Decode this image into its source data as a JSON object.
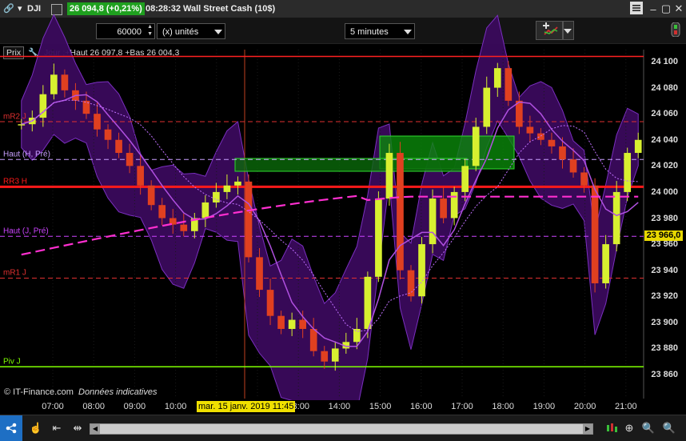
{
  "titlebar": {
    "symbol": "DJI",
    "quote": "26 094,8 (+0,21%)",
    "quote_color": "#1fa01f",
    "time": "08:28:32",
    "instrument": "Wall Street Cash (10$)"
  },
  "toolbar": {
    "units_value": "60000",
    "units_label": "(x) unités",
    "interval": "5 minutes"
  },
  "legend": {
    "price_label": "Prix",
    "day_info": "Jour :+Haut 26 097,8 +Bas 26 004,3"
  },
  "levels": [
    {
      "label": "mR2 J",
      "value": 24054,
      "color": "#e03030",
      "style": "dash"
    },
    {
      "label": "Haut (H, Pré)",
      "value": 24025,
      "color": "#c9a0ff",
      "style": "dash"
    },
    {
      "label": "RR3 H",
      "value": 24004,
      "color": "#ff1a1a",
      "style": "solid"
    },
    {
      "label": "Haut (J, Pré)",
      "value": 23966,
      "color": "#cc44ff",
      "style": "dash"
    },
    {
      "label": "mR1 J",
      "value": 23934,
      "color": "#e03030",
      "style": "dash"
    },
    {
      "label": "Piv J",
      "value": 23866,
      "color": "#7fff00",
      "style": "solid"
    }
  ],
  "top_line_value": 24104,
  "current_price_label": "23 966,0",
  "watermark": "© IT-Finance.com",
  "watermark_note": "Données indicatives",
  "cursor_label": "mar. 15 janv. 2019 11:45",
  "chart_data": {
    "type": "candlestick",
    "y_ticks": [
      "24 100",
      "24 080",
      "24 060",
      "24 040",
      "24 020",
      "24 000",
      "23 980",
      "23 960",
      "23 940",
      "23 920",
      "23 900",
      "23 880",
      "23 860"
    ],
    "y_values": [
      24100,
      24080,
      24060,
      24040,
      24020,
      24000,
      23980,
      23960,
      23940,
      23920,
      23900,
      23880,
      23860
    ],
    "ylim": [
      23851,
      24106
    ],
    "x_ticks": [
      "07:00",
      "08:00",
      "09:00",
      "10:00",
      "11:00",
      "12:00",
      "13:00",
      "14:00",
      "15:00",
      "16:00",
      "17:00",
      "18:00",
      "19:00",
      "20:00",
      "21:00"
    ],
    "close_path": [
      24052,
      24057,
      24075,
      24090,
      24078,
      24070,
      24060,
      24048,
      24040,
      24030,
      24020,
      24005,
      23990,
      23980,
      23975,
      23970,
      23980,
      23992,
      24000,
      24005,
      24008,
      23950,
      23925,
      23905,
      23895,
      23902,
      23895,
      23878,
      23870,
      23880,
      23885,
      23895,
      23935,
      23995,
      24030,
      23940,
      23920,
      23960,
      23995,
      23980,
      24000,
      24020,
      24050,
      24080,
      24095,
      24070,
      24050,
      24045,
      24040,
      24035,
      24025,
      24015,
      24005,
      23930,
      23960,
      24000,
      24030,
      24040
    ]
  }
}
